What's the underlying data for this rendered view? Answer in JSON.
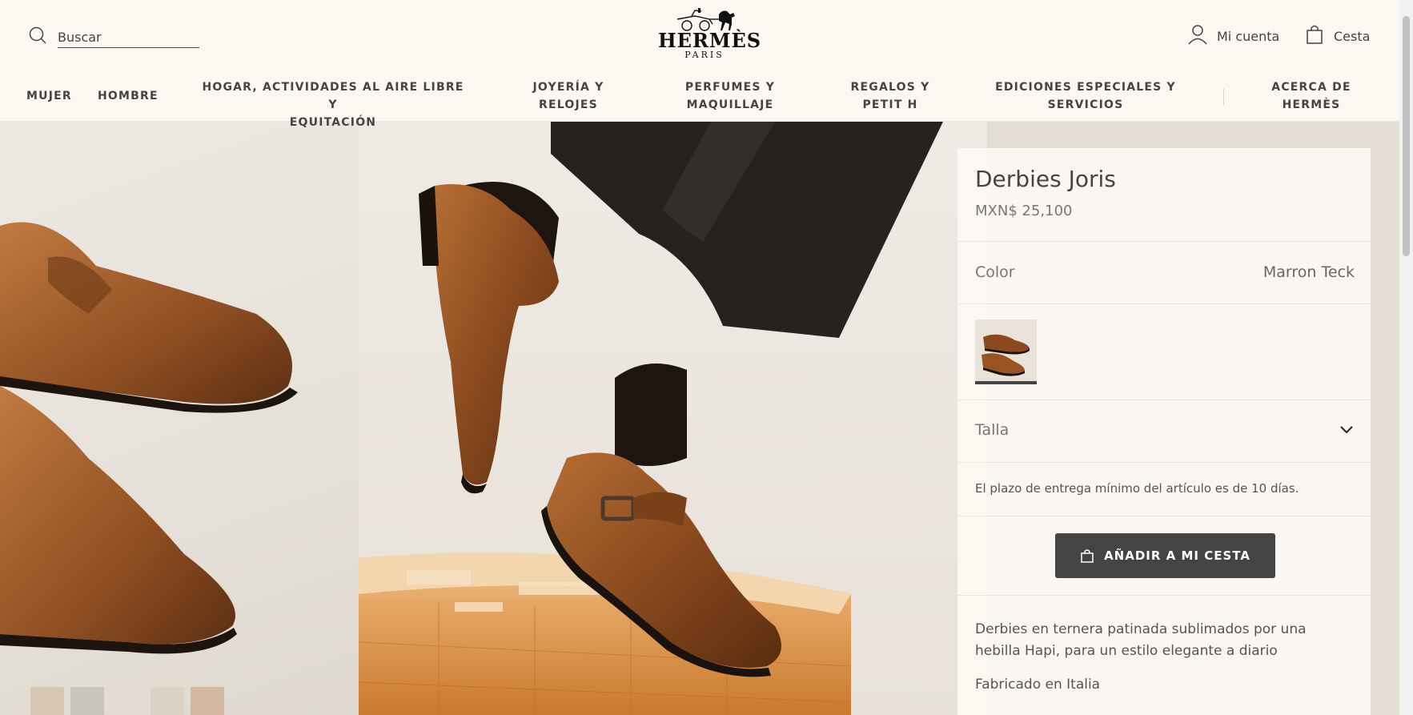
{
  "header": {
    "search": {
      "placeholder": "Buscar",
      "icon": "search-icon"
    },
    "logo": {
      "brand": "HERMÈS",
      "city": "PARIS"
    },
    "account_label": "Mi cuenta",
    "basket_label": "Cesta"
  },
  "nav": {
    "items": [
      {
        "line1": "MUJER",
        "line2": ""
      },
      {
        "line1": "HOMBRE",
        "line2": ""
      },
      {
        "line1": "HOGAR, ACTIVIDADES AL AIRE LIBRE Y",
        "line2": "EQUITACIÓN"
      },
      {
        "line1": "JOYERÍA Y",
        "line2": "RELOJES"
      },
      {
        "line1": "PERFUMES Y",
        "line2": "MAQUILLAJE"
      },
      {
        "line1": "REGALOS Y",
        "line2": "PETIT H"
      },
      {
        "line1": "EDICIONES ESPECIALES Y",
        "line2": "SERVICIOS"
      },
      {
        "line1": "ACERCA DE",
        "line2": "HERMÈS"
      }
    ]
  },
  "product": {
    "title": "Derbies Joris",
    "price": "MXN$ 25,100",
    "color_label": "Color",
    "color_value": "Marron Teck",
    "size_label": "Talla",
    "delivery_note": "El plazo de entrega mínimo del artículo es de 10 días.",
    "add_to_cart": "AÑADIR A MI CESTA",
    "description": "Derbies en ternera patinada sublimados por una hebilla Hapi, para un estilo elegante a diario",
    "made_in": "Fabricado en Italia"
  },
  "colors": {
    "background": "#fcf7f1",
    "button": "#444444",
    "leather": "#8a4f26",
    "box": "#d98a3a"
  }
}
